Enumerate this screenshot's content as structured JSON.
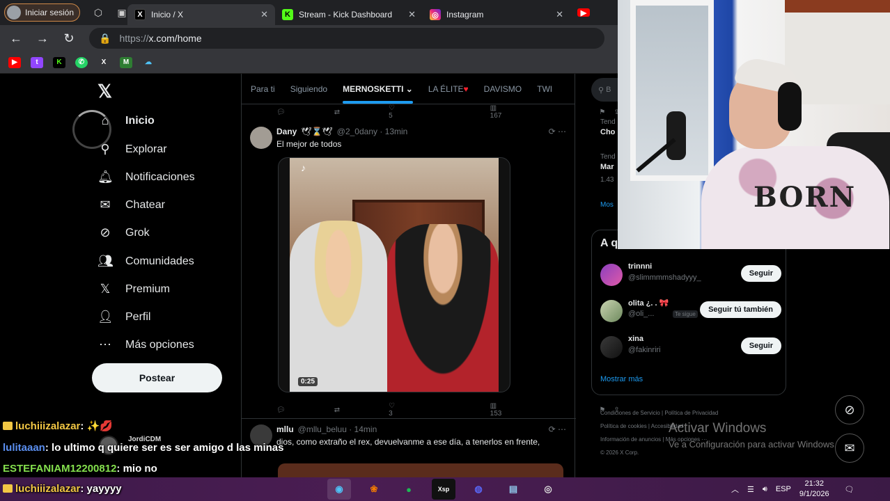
{
  "browser": {
    "profile_label": "Iniciar sesión",
    "tabs": [
      {
        "title": "Inicio / X",
        "favicon": "x-icon",
        "active": true
      },
      {
        "title": "Stream - Kick Dashboard",
        "favicon": "kick-icon",
        "active": false
      },
      {
        "title": "Instagram",
        "favicon": "instagram-icon",
        "active": false
      }
    ],
    "url_scheme": "https://",
    "url_host": "x.com/home",
    "bookmarks": [
      "youtube-icon",
      "twitch-icon",
      "kick-icon",
      "whatsapp-icon",
      "x-icon",
      "app-icon",
      "cloud-icon"
    ]
  },
  "x": {
    "nav": [
      {
        "label": "Inicio",
        "icon": "home-icon",
        "bold": true
      },
      {
        "label": "Explorar",
        "icon": "search-icon",
        "bold": false
      },
      {
        "label": "Notificaciones",
        "icon": "bell-icon",
        "bold": false
      },
      {
        "label": "Chatear",
        "icon": "mail-icon",
        "bold": false
      },
      {
        "label": "Grok",
        "icon": "grok-icon",
        "bold": false
      },
      {
        "label": "Comunidades",
        "icon": "people-icon",
        "bold": false
      },
      {
        "label": "Premium",
        "icon": "x-icon",
        "bold": false
      },
      {
        "label": "Perfil",
        "icon": "person-icon",
        "bold": false
      },
      {
        "label": "Más opciones",
        "icon": "more-icon",
        "bold": false
      }
    ],
    "post_button": "Postear",
    "feed_tabs": [
      "Para ti",
      "Siguiendo",
      "MERNOSKETTI",
      "LA ÉLITE",
      "DAVISMO",
      "TWI"
    ],
    "prev_actions": {
      "likes": "5",
      "views": "167"
    },
    "tweet1": {
      "name": "Dany",
      "handle": "@2_0dany · 13min",
      "text": "El mejor de todos",
      "video_time": "0:25",
      "likes": "3",
      "views": "153"
    },
    "tweet2": {
      "name": "mllu",
      "handle": "@mllu_beluu · 14min",
      "text": "dios, como extraño el rex, devuelvanme a ese día, a tenerlos en frente,"
    },
    "search_placeholder": "B",
    "trends": [
      {
        "label": "Tend",
        "bold": false
      },
      {
        "label": "Cho",
        "bold": true
      },
      {
        "label": "Tend",
        "bold": false
      },
      {
        "label": "Mar",
        "bold": true
      },
      {
        "label": "1.43",
        "bold": false
      },
      {
        "label": "Mos",
        "bold": false
      }
    ],
    "who_to_follow": {
      "title": "A q",
      "accounts": [
        {
          "name": "trinnni",
          "handle": "@slimmmmshadyyy_",
          "button": "Seguir",
          "follows_you": false
        },
        {
          "name": "olita ¿. . 🎀",
          "handle": "@oli_...",
          "button": "Seguir tú también",
          "follows_you": true
        },
        {
          "name": "xina",
          "handle": "@fakinriri",
          "button": "Seguir",
          "follows_you": false
        }
      ],
      "follows_you_label": "Te sigue",
      "show_more": "Mostrar más"
    },
    "footer": [
      "Condiciones de Servicio",
      "Política de Privacidad",
      "Política de cookies",
      "Accesibilidad",
      "Información de anuncios",
      "Más opciones ···",
      "© 2026 X Corp."
    ]
  },
  "chat": [
    {
      "user": "luchiiizalazar",
      "message": ": ✨💋",
      "color": "#f2c744"
    },
    {
      "user": "lulitaaan",
      "message": ": lo ultimo q quiere ser es ser amigo d las minas",
      "color": "#5b8ff0"
    },
    {
      "user": "ESTEFANIAM12200812",
      "message": ": mio no",
      "color": "#84e04d"
    },
    {
      "user": "luchiiizalazar",
      "message": ": yayyyy",
      "color": "#f2c744"
    }
  ],
  "chat_popup_name": "JordiCDM",
  "webcam": {
    "shirt_text": "BORN"
  },
  "windows": {
    "activate_title": "Activar Windows",
    "activate_sub": "Ve a Configuración para activar Windows.",
    "lang": "ESP",
    "time": "21:32",
    "date": "9/1/2026"
  }
}
